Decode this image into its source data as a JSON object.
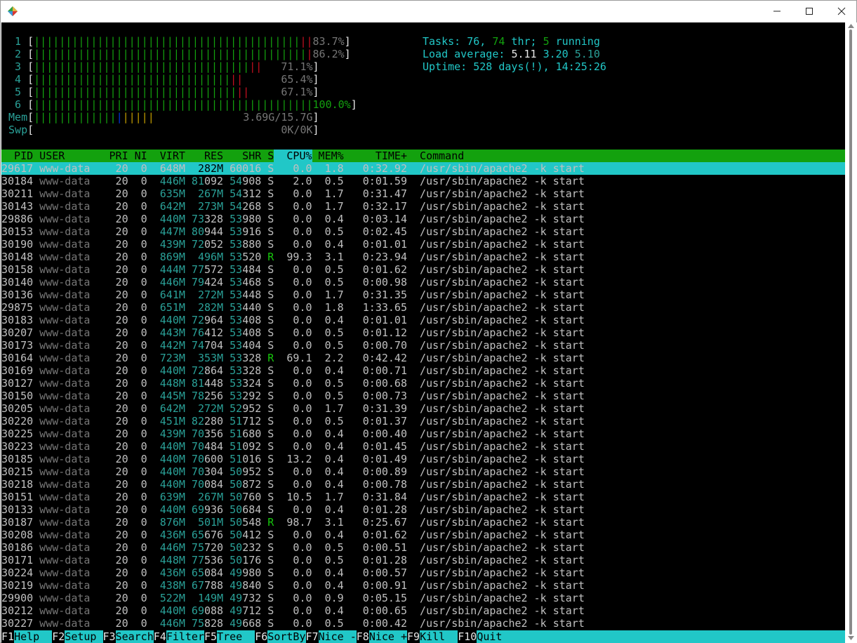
{
  "window": {
    "title": ""
  },
  "meters": {
    "cpus": [
      {
        "id": "1",
        "pct": "83.7%",
        "green": 42,
        "red": 2
      },
      {
        "id": "2",
        "pct": "86.2%",
        "green": 43,
        "red": 1
      },
      {
        "id": "3",
        "pct": "71.1%",
        "green": 34,
        "red": 2
      },
      {
        "id": "4",
        "pct": "65.4%",
        "green": 31,
        "red": 2
      },
      {
        "id": "5",
        "pct": "67.1%",
        "green": 32,
        "red": 2
      },
      {
        "id": "6",
        "pct": "100.0%",
        "green": 44,
        "red": 0
      }
    ],
    "mem": {
      "label": "Mem",
      "value": "3.69G/15.7G",
      "green": 13,
      "blue": 1,
      "orange": 5
    },
    "swp": {
      "label": "Swp",
      "value": "0K/0K"
    }
  },
  "summary": {
    "tasks_label": "Tasks:",
    "tasks": "76",
    "thr": "74",
    "thr_label": "thr;",
    "running": "5",
    "running_label": "running",
    "load_label": "Load average:",
    "load1": "5.11",
    "load5": "3.20",
    "load15": "5.10",
    "uptime_label": "Uptime:",
    "uptime": "528 days(!), 14:25:26"
  },
  "columns": [
    "PID",
    "USER",
    "PRI",
    "NI",
    "VIRT",
    "RES",
    "SHR",
    "S",
    "CPU%",
    "MEM%",
    "TIME+",
    "Command"
  ],
  "processes": [
    [
      "29617",
      "www-data",
      "20",
      "0",
      "648M",
      "282M",
      "60016",
      "S",
      "0.0",
      "1.8",
      "0:32.92",
      "/usr/sbin/apache2 -k start"
    ],
    [
      "30184",
      "www-data",
      "20",
      "0",
      "446M",
      "81092",
      "54908",
      "S",
      "2.0",
      "0.5",
      "0:01.59",
      "/usr/sbin/apache2 -k start"
    ],
    [
      "30211",
      "www-data",
      "20",
      "0",
      "635M",
      "267M",
      "54312",
      "S",
      "0.0",
      "1.7",
      "0:31.47",
      "/usr/sbin/apache2 -k start"
    ],
    [
      "30143",
      "www-data",
      "20",
      "0",
      "642M",
      "273M",
      "54268",
      "S",
      "0.0",
      "1.7",
      "0:32.17",
      "/usr/sbin/apache2 -k start"
    ],
    [
      "29886",
      "www-data",
      "20",
      "0",
      "440M",
      "73328",
      "53980",
      "S",
      "0.0",
      "0.4",
      "0:03.14",
      "/usr/sbin/apache2 -k start"
    ],
    [
      "30153",
      "www-data",
      "20",
      "0",
      "447M",
      "80944",
      "53916",
      "S",
      "0.0",
      "0.5",
      "0:02.45",
      "/usr/sbin/apache2 -k start"
    ],
    [
      "30190",
      "www-data",
      "20",
      "0",
      "439M",
      "72052",
      "53880",
      "S",
      "0.0",
      "0.4",
      "0:01.01",
      "/usr/sbin/apache2 -k start"
    ],
    [
      "30148",
      "www-data",
      "20",
      "0",
      "869M",
      "496M",
      "53520",
      "R",
      "99.3",
      "3.1",
      "0:23.94",
      "/usr/sbin/apache2 -k start"
    ],
    [
      "30158",
      "www-data",
      "20",
      "0",
      "444M",
      "77572",
      "53484",
      "S",
      "0.0",
      "0.5",
      "0:01.62",
      "/usr/sbin/apache2 -k start"
    ],
    [
      "30140",
      "www-data",
      "20",
      "0",
      "446M",
      "79424",
      "53468",
      "S",
      "0.0",
      "0.5",
      "0:00.98",
      "/usr/sbin/apache2 -k start"
    ],
    [
      "30136",
      "www-data",
      "20",
      "0",
      "641M",
      "272M",
      "53448",
      "S",
      "0.0",
      "1.7",
      "0:31.35",
      "/usr/sbin/apache2 -k start"
    ],
    [
      "29875",
      "www-data",
      "20",
      "0",
      "651M",
      "282M",
      "53440",
      "S",
      "0.0",
      "1.8",
      "1:33.65",
      "/usr/sbin/apache2 -k start"
    ],
    [
      "30183",
      "www-data",
      "20",
      "0",
      "440M",
      "72964",
      "53408",
      "S",
      "0.0",
      "0.4",
      "0:01.01",
      "/usr/sbin/apache2 -k start"
    ],
    [
      "30207",
      "www-data",
      "20",
      "0",
      "443M",
      "76412",
      "53408",
      "S",
      "0.0",
      "0.5",
      "0:01.12",
      "/usr/sbin/apache2 -k start"
    ],
    [
      "30173",
      "www-data",
      "20",
      "0",
      "442M",
      "74704",
      "53404",
      "S",
      "0.0",
      "0.5",
      "0:00.70",
      "/usr/sbin/apache2 -k start"
    ],
    [
      "30164",
      "www-data",
      "20",
      "0",
      "723M",
      "353M",
      "53328",
      "R",
      "69.1",
      "2.2",
      "0:42.42",
      "/usr/sbin/apache2 -k start"
    ],
    [
      "30169",
      "www-data",
      "20",
      "0",
      "440M",
      "72864",
      "53328",
      "S",
      "0.0",
      "0.4",
      "0:00.71",
      "/usr/sbin/apache2 -k start"
    ],
    [
      "30127",
      "www-data",
      "20",
      "0",
      "448M",
      "81448",
      "53324",
      "S",
      "0.0",
      "0.5",
      "0:00.68",
      "/usr/sbin/apache2 -k start"
    ],
    [
      "30150",
      "www-data",
      "20",
      "0",
      "445M",
      "78256",
      "53292",
      "S",
      "0.0",
      "0.5",
      "0:00.73",
      "/usr/sbin/apache2 -k start"
    ],
    [
      "30205",
      "www-data",
      "20",
      "0",
      "642M",
      "272M",
      "52952",
      "S",
      "0.0",
      "1.7",
      "0:31.39",
      "/usr/sbin/apache2 -k start"
    ],
    [
      "30220",
      "www-data",
      "20",
      "0",
      "451M",
      "82280",
      "51712",
      "S",
      "0.0",
      "0.5",
      "0:01.37",
      "/usr/sbin/apache2 -k start"
    ],
    [
      "30225",
      "www-data",
      "20",
      "0",
      "439M",
      "70356",
      "51680",
      "S",
      "0.0",
      "0.4",
      "0:00.40",
      "/usr/sbin/apache2 -k start"
    ],
    [
      "30223",
      "www-data",
      "20",
      "0",
      "440M",
      "70484",
      "51092",
      "S",
      "0.0",
      "0.4",
      "0:01.45",
      "/usr/sbin/apache2 -k start"
    ],
    [
      "30185",
      "www-data",
      "20",
      "0",
      "440M",
      "70600",
      "51016",
      "S",
      "13.2",
      "0.4",
      "0:01.49",
      "/usr/sbin/apache2 -k start"
    ],
    [
      "30215",
      "www-data",
      "20",
      "0",
      "440M",
      "70304",
      "50952",
      "S",
      "0.0",
      "0.4",
      "0:00.89",
      "/usr/sbin/apache2 -k start"
    ],
    [
      "30218",
      "www-data",
      "20",
      "0",
      "440M",
      "70084",
      "50872",
      "S",
      "0.0",
      "0.4",
      "0:00.78",
      "/usr/sbin/apache2 -k start"
    ],
    [
      "30151",
      "www-data",
      "20",
      "0",
      "639M",
      "267M",
      "50760",
      "S",
      "10.5",
      "1.7",
      "0:31.84",
      "/usr/sbin/apache2 -k start"
    ],
    [
      "30133",
      "www-data",
      "20",
      "0",
      "440M",
      "69936",
      "50684",
      "S",
      "0.0",
      "0.4",
      "0:01.28",
      "/usr/sbin/apache2 -k start"
    ],
    [
      "30187",
      "www-data",
      "20",
      "0",
      "876M",
      "501M",
      "50548",
      "R",
      "98.7",
      "3.1",
      "0:25.67",
      "/usr/sbin/apache2 -k start"
    ],
    [
      "30208",
      "www-data",
      "20",
      "0",
      "436M",
      "65676",
      "50412",
      "S",
      "0.0",
      "0.4",
      "0:01.62",
      "/usr/sbin/apache2 -k start"
    ],
    [
      "30186",
      "www-data",
      "20",
      "0",
      "446M",
      "75720",
      "50232",
      "S",
      "0.0",
      "0.5",
      "0:00.51",
      "/usr/sbin/apache2 -k start"
    ],
    [
      "30171",
      "www-data",
      "20",
      "0",
      "448M",
      "77536",
      "50176",
      "S",
      "0.0",
      "0.5",
      "0:01.28",
      "/usr/sbin/apache2 -k start"
    ],
    [
      "30224",
      "www-data",
      "20",
      "0",
      "436M",
      "65084",
      "49980",
      "S",
      "0.0",
      "0.4",
      "0:00.57",
      "/usr/sbin/apache2 -k start"
    ],
    [
      "30219",
      "www-data",
      "20",
      "0",
      "438M",
      "67788",
      "49840",
      "S",
      "0.0",
      "0.4",
      "0:00.91",
      "/usr/sbin/apache2 -k start"
    ],
    [
      "29900",
      "www-data",
      "20",
      "0",
      "522M",
      "149M",
      "49732",
      "S",
      "0.0",
      "0.9",
      "0:05.15",
      "/usr/sbin/apache2 -k start"
    ],
    [
      "30212",
      "www-data",
      "20",
      "0",
      "440M",
      "69088",
      "49712",
      "S",
      "0.0",
      "0.4",
      "0:00.65",
      "/usr/sbin/apache2 -k start"
    ],
    [
      "30227",
      "www-data",
      "20",
      "0",
      "446M",
      "75828",
      "49668",
      "S",
      "0.0",
      "0.5",
      "0:00.42",
      "/usr/sbin/apache2 -k start"
    ]
  ],
  "footer": [
    {
      "key": "F1",
      "label": "Help  "
    },
    {
      "key": "F2",
      "label": "Setup "
    },
    {
      "key": "F3",
      "label": "Search"
    },
    {
      "key": "F4",
      "label": "Filter"
    },
    {
      "key": "F5",
      "label": "Tree  "
    },
    {
      "key": "F6",
      "label": "SortBy"
    },
    {
      "key": "F7",
      "label": "Nice -"
    },
    {
      "key": "F8",
      "label": "Nice +"
    },
    {
      "key": "F9",
      "label": "Kill  "
    },
    {
      "key": "F10",
      "label": "Quit"
    }
  ],
  "colors": {
    "green": "#13a10e",
    "cyan": "#21c7c7",
    "red": "#c50f1f",
    "orange": "#c19c00",
    "blue": "#0037da"
  }
}
